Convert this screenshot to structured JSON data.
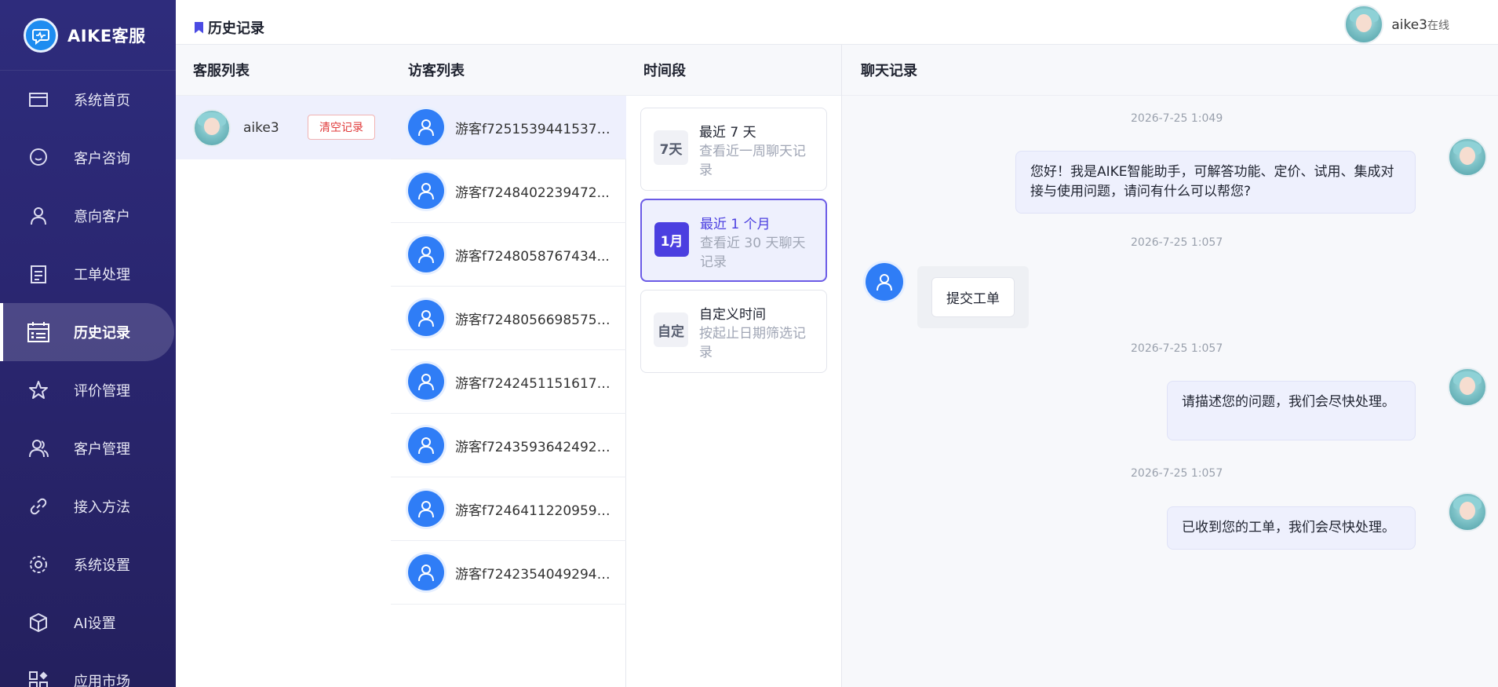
{
  "brand": {
    "name": "AIKE客服"
  },
  "sidebar": {
    "items": [
      {
        "label": "系统首页",
        "icon": "dashboard-icon"
      },
      {
        "label": "客户咨询",
        "icon": "chat-icon"
      },
      {
        "label": "意向客户",
        "icon": "user-icon"
      },
      {
        "label": "工单处理",
        "icon": "clipboard-icon"
      },
      {
        "label": "历史记录",
        "icon": "history-icon",
        "active": true
      },
      {
        "label": "评价管理",
        "icon": "star-icon"
      },
      {
        "label": "客户管理",
        "icon": "users-icon"
      },
      {
        "label": "接入方法",
        "icon": "link-icon"
      },
      {
        "label": "系统设置",
        "icon": "gear-icon"
      },
      {
        "label": "AI设置",
        "icon": "cube-icon"
      },
      {
        "label": "应用市场",
        "icon": "apps-icon"
      }
    ]
  },
  "header": {
    "title": "历史记录",
    "user": {
      "name": "aike3",
      "status": "在线"
    }
  },
  "agents": {
    "title": "客服列表",
    "rows": [
      {
        "name": "aike3",
        "clear_label": "清空记录"
      }
    ]
  },
  "visitors": {
    "title": "访客列表",
    "rows": [
      "游客f72515394415373...",
      "游客f7248402239472...",
      "游客f7248058767434...",
      "游客f72480566985755...",
      "游客f7242451151617b...",
      "游客f72435936424929...",
      "游客f7246411220959v...",
      "游客f72423540492945..."
    ]
  },
  "time_range": {
    "title": "时间段",
    "cards": [
      {
        "badge": "7天",
        "title": "最近 7 天",
        "desc": "查看近一周聊天记录"
      },
      {
        "badge": "1月",
        "title": "最近 1 个月",
        "desc": "查看近 30 天聊天记录",
        "active": true
      },
      {
        "badge": "自定",
        "title": "自定义时间",
        "desc": "按起止日期筛选记录"
      }
    ]
  },
  "chat": {
    "title": "聊天记录",
    "messages": [
      {
        "time": "2026-7-25 1:049",
        "side": "right",
        "text": "您好！我是AIKE智能助手，可解答功能、定价、试用、集成对接与使用问题，请问有什么可以帮您?"
      },
      {
        "time": "2026-7-25 1:057",
        "side": "left",
        "text": "提交工单"
      },
      {
        "time": "2026-7-25 1:057",
        "side": "right",
        "text": "请描述您的问题，我们会尽快处理。"
      },
      {
        "time": "2026-7-25 1:057",
        "side": "right",
        "text": "已收到您的工单，我们会尽快处理。"
      }
    ]
  }
}
